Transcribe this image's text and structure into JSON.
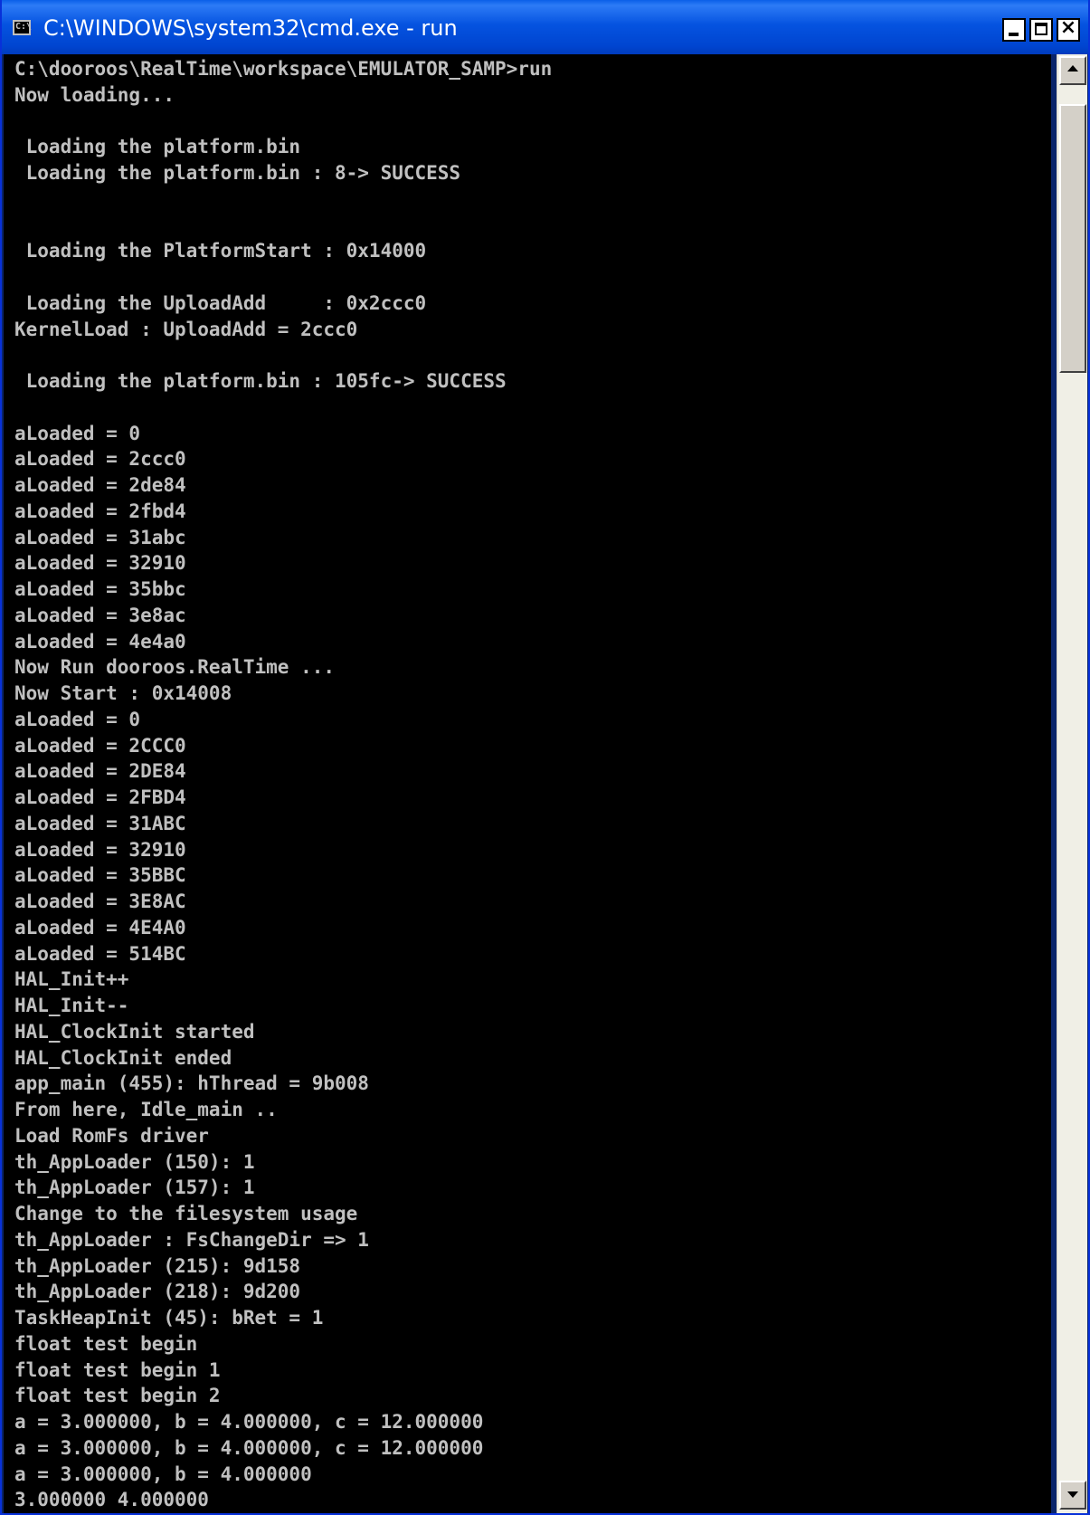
{
  "window": {
    "title": "C:\\WINDOWS\\system32\\cmd.exe - run",
    "icon": "cmd-console-icon",
    "icon_text": "C:\\",
    "accent_color": "#0553e0",
    "console_text_color": "#c0c0c0",
    "console_background_color": "#000000"
  },
  "console": {
    "lines": [
      "C:\\dooroos\\RealTime\\workspace\\EMULATOR_SAMP>run",
      "Now loading...",
      "",
      " Loading the platform.bin",
      " Loading the platform.bin : 8-> SUCCESS",
      "",
      "",
      " Loading the PlatformStart : 0x14000",
      "",
      " Loading the UploadAdd     : 0x2ccc0",
      "KernelLoad : UploadAdd = 2ccc0",
      "",
      " Loading the platform.bin : 105fc-> SUCCESS",
      "",
      "aLoaded = 0",
      "aLoaded = 2ccc0",
      "aLoaded = 2de84",
      "aLoaded = 2fbd4",
      "aLoaded = 31abc",
      "aLoaded = 32910",
      "aLoaded = 35bbc",
      "aLoaded = 3e8ac",
      "aLoaded = 4e4a0",
      "Now Run dooroos.RealTime ...",
      "Now Start : 0x14008",
      "aLoaded = 0",
      "aLoaded = 2CCC0",
      "aLoaded = 2DE84",
      "aLoaded = 2FBD4",
      "aLoaded = 31ABC",
      "aLoaded = 32910",
      "aLoaded = 35BBC",
      "aLoaded = 3E8AC",
      "aLoaded = 4E4A0",
      "aLoaded = 514BC",
      "HAL_Init++",
      "HAL_Init--",
      "HAL_ClockInit started",
      "HAL_ClockInit ended",
      "app_main (455): hThread = 9b008",
      "From here, Idle_main ..",
      "Load RomFs driver",
      "th_AppLoader (150): 1",
      "th_AppLoader (157): 1",
      "Change to the filesystem usage",
      "th_AppLoader : FsChangeDir => 1",
      "th_AppLoader (215): 9d158",
      "th_AppLoader (218): 9d200",
      "TaskHeapInit (45): bRet = 1",
      "float test begin",
      "float test begin 1",
      "float test begin 2",
      "a = 3.000000, b = 4.000000, c = 12.000000",
      "a = 3.000000, b = 4.000000, c = 12.000000",
      "a = 3.000000, b = 4.000000",
      "3.000000 4.000000"
    ]
  },
  "scrollbar": {
    "up_icon": "scroll-up-arrow-icon",
    "down_icon": "scroll-down-arrow-icon"
  },
  "controls": {
    "minimize_icon": "minimize-icon",
    "maximize_icon": "maximize-icon",
    "close_icon": "close-icon",
    "close_glyph": "×"
  }
}
